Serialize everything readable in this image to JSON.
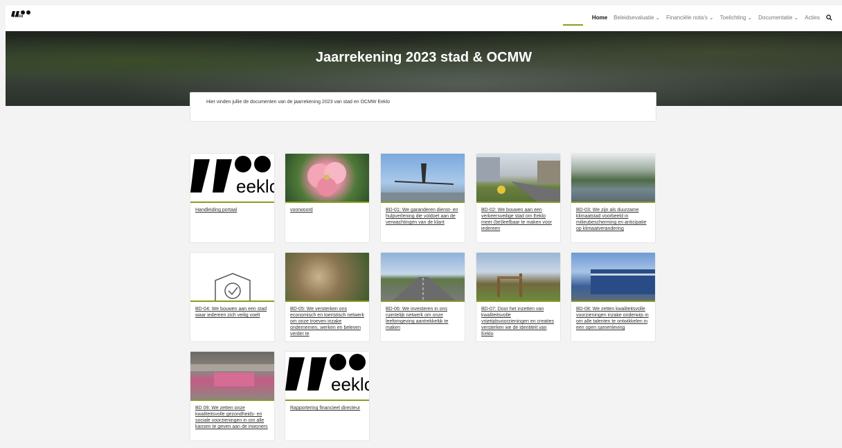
{
  "header": {
    "logo_text": "eeklo",
    "nav": [
      {
        "label": "Home",
        "active": true
      },
      {
        "label": "Beleidsevaluatie",
        "dropdown": true
      },
      {
        "label": "Financiële nota's",
        "dropdown": true
      },
      {
        "label": "Toelichting",
        "dropdown": true
      },
      {
        "label": "Documentatie",
        "dropdown": true
      },
      {
        "label": "Acties"
      }
    ],
    "accent": "#8a9b1f"
  },
  "hero": {
    "title": "Jaarrekening 2023 stad & OCMW"
  },
  "intro": {
    "text": "Hier vinden jullie de documenten van de jaarrekening 2023 van stad en OCMW Eeklo"
  },
  "cards": [
    {
      "label": "Handleiding portaal",
      "image": "eeklo-logo"
    },
    {
      "label": "voorwoord",
      "image": "pink-flower-photo"
    },
    {
      "label": "BD-01: We garanderen dienst- en hulpverlening die voldoet aan de verwachtingen van de klant",
      "image": "sculpture-photo"
    },
    {
      "label": "BD-02: We bouwen aan een verkeersveilige stad om Eeklo meer (be)leefbaar te maken voor iedereen",
      "image": "street-photo"
    },
    {
      "label": "BD-03: We zijn als duurzame klimaatstad voorbeeld in milieubescherming en anticipatie op klimaatverandering",
      "image": "lake-photo"
    },
    {
      "label": "BD-04: We bouwen aan een stad waar iedereen zich veilig voelt",
      "image": "shield-check-icon"
    },
    {
      "label": "BD-05: We versterken ons economisch en toeristisch netwerk om onze troeven inzake ondernemen, werken en beleven verder te",
      "image": "terrace-photo"
    },
    {
      "label": "BD-06: We investeren in ons ruimtelijk netwerk om onze leefomgeving aantrekkelijk te maken",
      "image": "road-photo"
    },
    {
      "label": "BD-07: Door het inzetten van kwaliteitsvolle vrijetijdsvoorzieningen en creaties versterken we de identiteit van Eeklo",
      "image": "playground-photo"
    },
    {
      "label": "BD-08: We zetten kwaliteitsvolle voorzieningen inzake onderwijs in om alle talenten te ontwikkelen in een open samenleving",
      "image": "building-photo"
    },
    {
      "label": "BD 09: We zetten onze kwaliteitsvolle gezondheids- en sociale voorzieningen in om alle kansen te geven aan de inwoners",
      "image": "pink-building-photo"
    },
    {
      "label": "Rapportering financieel directeur",
      "image": "eeklo-logo"
    }
  ]
}
